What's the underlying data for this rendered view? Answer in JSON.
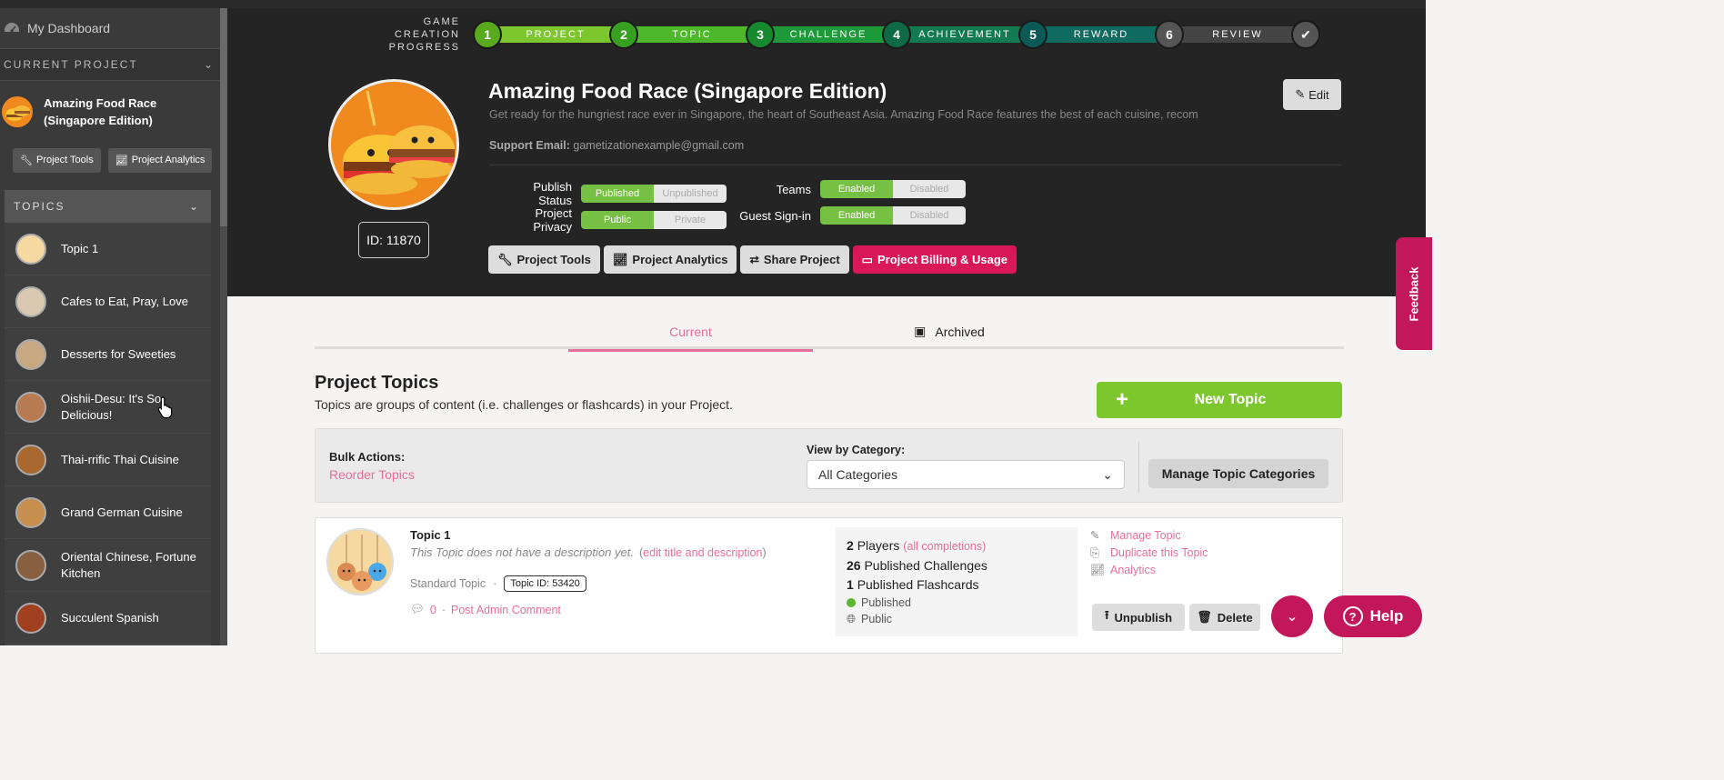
{
  "sidebar": {
    "dashboard_label": "My Dashboard",
    "current_project_heading": "CURRENT PROJECT",
    "project_name_line1": "Amazing Food Race",
    "project_name_line2": "(Singapore Edition)",
    "project_tools_label": "Project Tools",
    "project_analytics_label": "Project Analytics",
    "topics_heading": "TOPICS",
    "topics": [
      {
        "label": "Topic 1",
        "color": "#f6d9a0"
      },
      {
        "label": "Cafes to Eat, Pray, Love",
        "color": "#d8c8b0"
      },
      {
        "label": "Desserts for Sweeties",
        "color": "#c8a880"
      },
      {
        "label": "Oishii-Desu: It's So Delicious!",
        "color": "#b87a50"
      },
      {
        "label": "Thai-rrific Thai Cuisine",
        "color": "#a86830"
      },
      {
        "label": "Grand German Cuisine",
        "color": "#c89050"
      },
      {
        "label": "Oriental Chinese, Fortune Kitchen",
        "color": "#886040"
      },
      {
        "label": "Succulent Spanish",
        "color": "#a04020"
      }
    ]
  },
  "progress": {
    "label_line1": "GAME CREATION",
    "label_line2": "PROGRESS",
    "steps": [
      {
        "num": "1",
        "label": "PROJECT",
        "color": "#7dc72e",
        "dot": "#5aaa1e"
      },
      {
        "num": "2",
        "label": "TOPIC",
        "color": "#4db82a",
        "dot": "#38a020"
      },
      {
        "num": "3",
        "label": "CHALLENGE",
        "color": "#1f9a3a",
        "dot": "#178a30"
      },
      {
        "num": "4",
        "label": "ACHIEVEMENT",
        "color": "#127a50",
        "dot": "#0e6a45"
      },
      {
        "num": "5",
        "label": "REWARD",
        "color": "#0f6a60",
        "dot": "#0c5a55"
      },
      {
        "num": "6",
        "label": "REVIEW",
        "color": "#444444",
        "dot": "#555555"
      }
    ],
    "final_icon": "check-icon"
  },
  "project": {
    "title": "Amazing Food Race (Singapore Edition)",
    "description": "Get ready for the hungriest race ever in Singapore, the heart of Southeast Asia. Amazing Food Race features the best of each cuisine, recom...",
    "support_label": "Support Email:",
    "support_email": "gametizationexample@gmail.com",
    "id_label": "ID: 11870",
    "edit_label": "Edit",
    "publish_status_label": "Publish Status",
    "publish_on": "Published",
    "publish_off": "Unpublished",
    "privacy_label": "Project Privacy",
    "privacy_on": "Public",
    "privacy_off": "Private",
    "teams_label": "Teams",
    "teams_on": "Enabled",
    "teams_off": "Disabled",
    "guest_label": "Guest Sign-in",
    "guest_on": "Enabled",
    "guest_off": "Disabled",
    "actions": {
      "tools": "Project Tools",
      "analytics": "Project Analytics",
      "share": "Share Project",
      "billing": "Project Billing & Usage"
    }
  },
  "tabs": {
    "current": "Current",
    "archived": "Archived"
  },
  "topics_section": {
    "title": "Project Topics",
    "subtitle": "Topics are groups of content (i.e. challenges or flashcards) in your Project.",
    "new_topic_label": "New Topic",
    "bulk_actions_label": "Bulk Actions:",
    "reorder_label": "Reorder Topics",
    "view_by_category_label": "View by Category:",
    "category_selected": "All Categories",
    "manage_categories_label": "Manage Topic Categories"
  },
  "topic_card": {
    "title": "Topic 1",
    "description": "This Topic does not have a description yet.",
    "edit_link": "edit title and description",
    "type": "Standard Topic",
    "topic_id": "Topic ID: 53420",
    "comment_count": "0",
    "post_comment": "Post Admin Comment",
    "players_count": "2",
    "players_label": "Players",
    "all_completions": "all completions",
    "challenges_count": "26",
    "challenges_label": "Published Challenges",
    "flashcards_count": "1",
    "flashcards_label": "Published Flashcards",
    "status_published": "Published",
    "status_public": "Public",
    "manage_topic": "Manage Topic",
    "duplicate_topic": "Duplicate this Topic",
    "analytics": "Analytics",
    "unpublish": "Unpublish",
    "delete": "Delete"
  },
  "floating": {
    "feedback": "Feedback",
    "help": "Help"
  }
}
